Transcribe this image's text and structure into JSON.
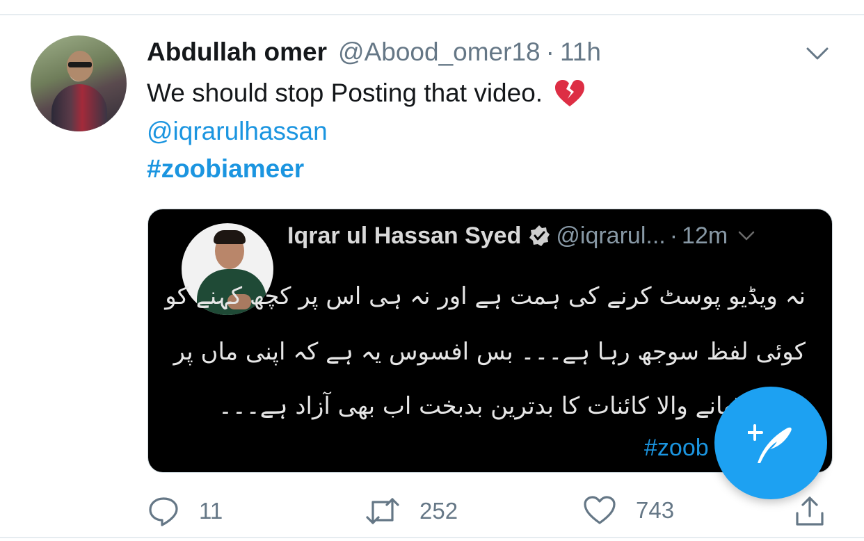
{
  "tweet": {
    "author_name": "Abdullah omer",
    "author_handle": "@Abood_omer18",
    "separator": "·",
    "time": "11h",
    "text": "We should stop Posting that video.",
    "mention": "@iqrarulhassan",
    "hashtag": "#zoobiameer"
  },
  "embedded_media": {
    "author_name": "Iqrar ul Hassan Syed",
    "author_handle": "@iqrarul...",
    "separator": "·",
    "time": "12m",
    "lines": [
      "نہ ویڈیو پوسٹ کرنے کی ہمت ہے اور نہ ہی اس پر کچھ کہنے کو",
      "کوئی لفظ سوجھ رہا ہے۔۔۔ بس افسوس یہ ہے کہ اپنی ماں پر",
      "ہاتھ اٹھانے والا کائنات کا بدترین بدبخت اب بھی آزاد ہے۔۔۔"
    ],
    "hashtag_partial": "#zoob"
  },
  "actions": {
    "reply_count": "11",
    "retweet_count": "252",
    "like_count": "743"
  },
  "colors": {
    "accent": "#1da1f2",
    "link": "#1b95e0",
    "text": "#14171a",
    "secondary": "#657786",
    "heart": "#e0245e"
  },
  "icons": {
    "broken_heart": "broken-heart-icon",
    "chevron": "chevron-down-icon",
    "verified": "verified-badge-icon",
    "reply": "reply-icon",
    "retweet": "retweet-icon",
    "like": "heart-icon",
    "share": "share-icon",
    "compose": "compose-tweet-icon"
  }
}
